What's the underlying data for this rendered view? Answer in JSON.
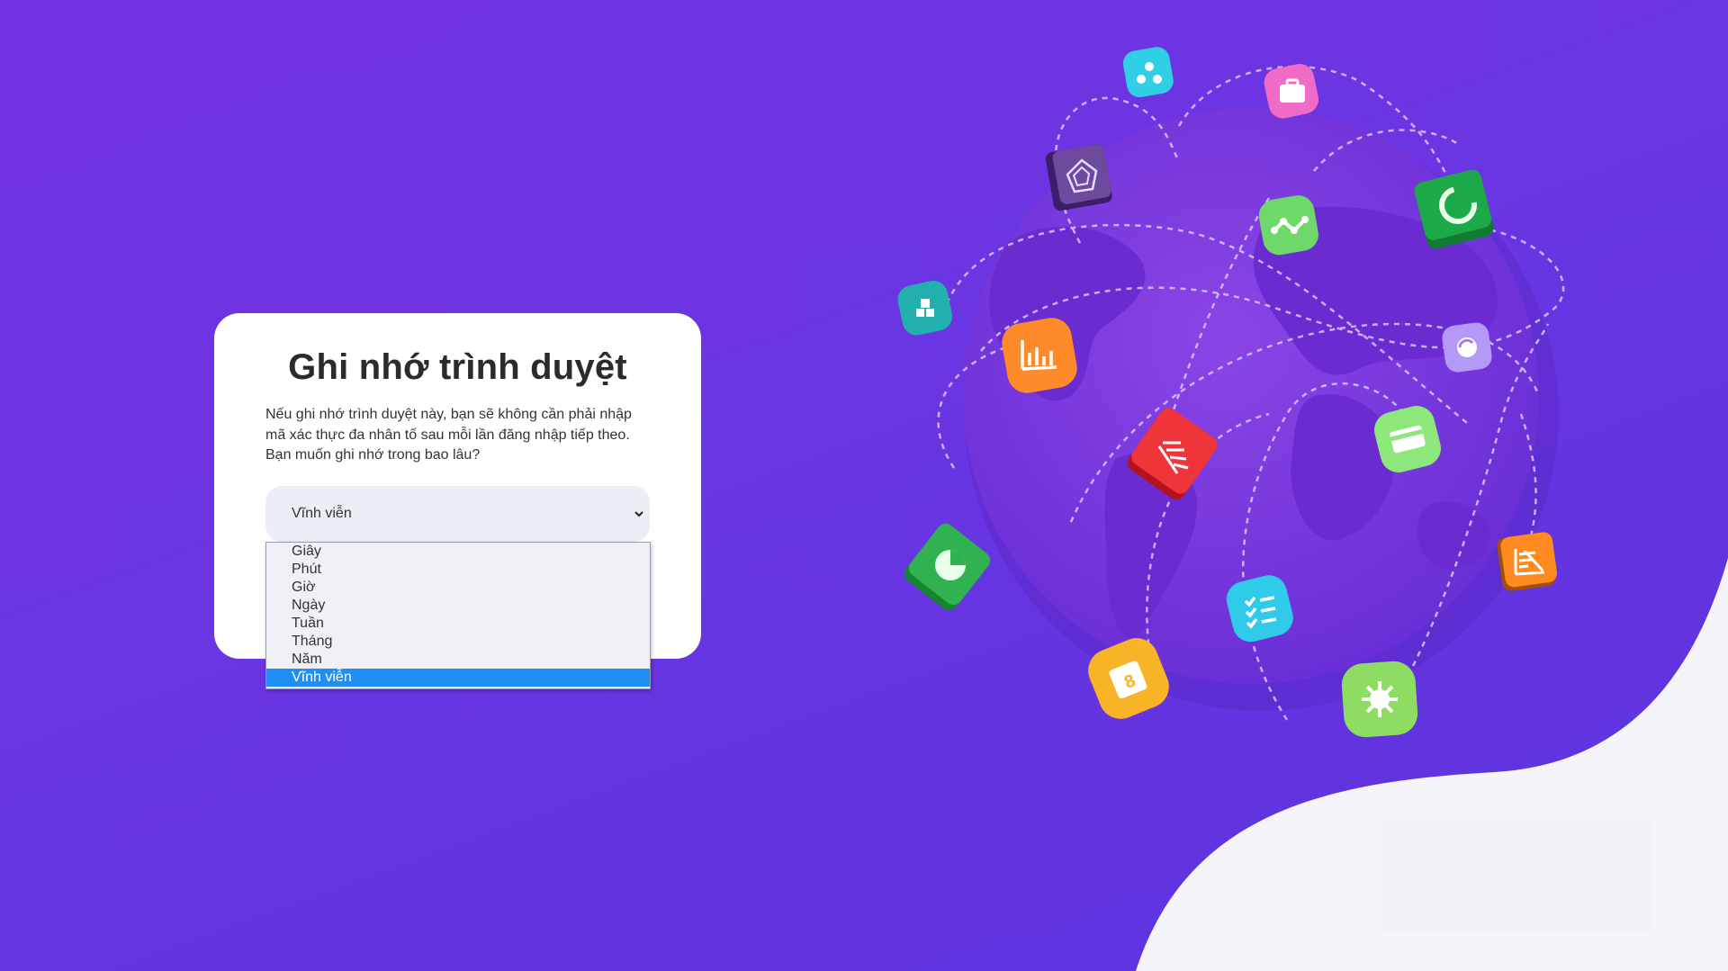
{
  "dialog": {
    "title": "Ghi nhớ trình duyệt",
    "description": "Nếu ghi nhớ trình duyệt này, bạn sẽ không cần phải nhập mã xác thực đa nhân tố sau mỗi lần đăng nhập tiếp theo. Bạn muốn ghi nhớ trong bao lâu?",
    "duration_select": {
      "value": "Vĩnh viễn",
      "icon": "chevron-down-icon"
    },
    "duration_options": [
      {
        "label": "Giây"
      },
      {
        "label": "Phút"
      },
      {
        "label": "Giờ"
      },
      {
        "label": "Ngày"
      },
      {
        "label": "Tuần"
      },
      {
        "label": "Tháng"
      },
      {
        "label": "Năm"
      },
      {
        "label": "Vĩnh viễn",
        "selected": true
      }
    ]
  },
  "illustration": {
    "icons": [
      "network-icon",
      "briefcase-icon",
      "radar-chart-icon",
      "graph-line-icon",
      "donut-chart-icon",
      "blocks-icon",
      "bar-chart-up-icon",
      "refresh-globe-icon",
      "bar-chart-3d-icon",
      "credit-card-icon",
      "pie-chart-icon",
      "checklist-icon",
      "funnel-chart-icon",
      "calendar-icon",
      "virus-icon"
    ]
  },
  "colors": {
    "background": "#6a35e2",
    "card": "#ffffff",
    "select_background": "#eceef6",
    "option_highlight": "#1f8ff5"
  }
}
